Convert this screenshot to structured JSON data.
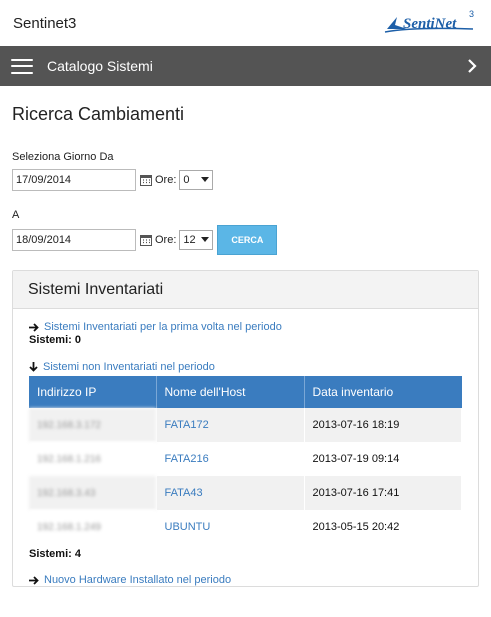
{
  "header": {
    "app_title": "Sentinet3",
    "logo_text": "SentiNet",
    "logo_superscript": "3"
  },
  "navbar": {
    "title": "Catalogo Sistemi"
  },
  "page": {
    "title": "Ricerca Cambiamenti"
  },
  "form": {
    "from_label": "Seleziona Giorno Da",
    "from_date": "17/09/2014",
    "ore_label": "Ore:",
    "from_hour": "0",
    "to_label": "A",
    "to_date": "18/09/2014",
    "to_hour": "12",
    "search_button": "CERCA"
  },
  "panel": {
    "title": "Sistemi Inventariati",
    "first_link": "Sistemi Inventariati per la prima volta nel periodo",
    "first_count": "Sistemi: 0",
    "second_link": "Sistemi non Inventariati nel periodo",
    "table": {
      "headers": [
        "Indirizzo IP",
        "Nome dell'Host",
        "Data inventario"
      ],
      "rows": [
        {
          "ip": "192.168.3.172",
          "host": "FATA172",
          "date": "2013-07-16 18:19"
        },
        {
          "ip": "192.168.1.216",
          "host": "FATA216",
          "date": "2013-07-19 09:14"
        },
        {
          "ip": "192.168.3.43",
          "host": "FATA43",
          "date": "2013-07-16 17:41"
        },
        {
          "ip": "192.168.1.249",
          "host": "UBUNTU",
          "date": "2013-05-15 20:42"
        }
      ]
    },
    "second_count": "Sistemi: 4",
    "third_link": "Nuovo Hardware Installato nel periodo"
  },
  "colors": {
    "navbar": "#545454",
    "accent": "#3a7cbf",
    "button": "#5bb6e6",
    "logo": "#1d5fa8"
  },
  "icons": {
    "menu": "hamburger-icon",
    "chevron": "chevron-right-icon",
    "calendar": "calendar-icon",
    "arrow_right": "arrow-right-icon",
    "arrow_down": "arrow-down-icon"
  }
}
